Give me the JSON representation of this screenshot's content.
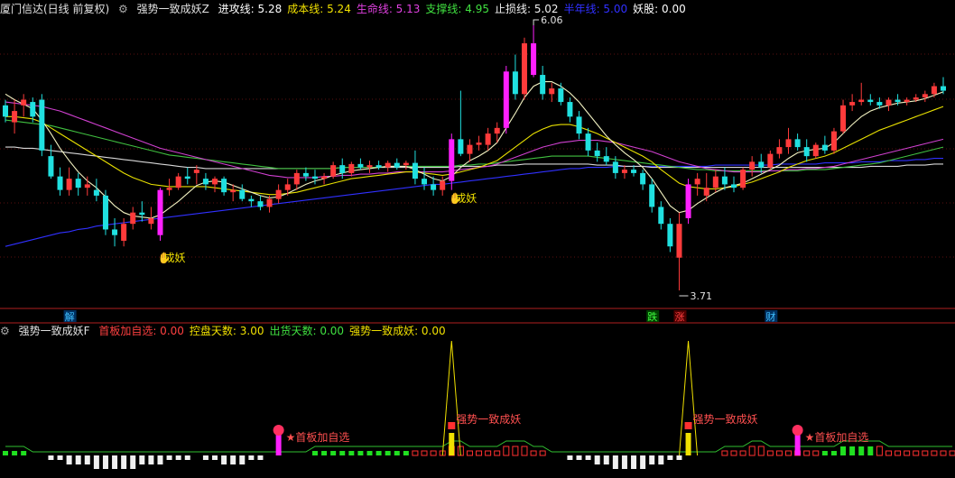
{
  "main": {
    "title": "厦门信达(日线 前复权)",
    "indicator": "强势一致成妖Z",
    "lines": [
      {
        "label": "进攻线: 5.28",
        "color": "#ffffff"
      },
      {
        "label": "成本线: 5.24",
        "color": "#f0e000"
      },
      {
        "label": "生命线: 5.13",
        "color": "#e040e0"
      },
      {
        "label": "支撑线: 4.95",
        "color": "#40e040"
      },
      {
        "label": "止损线: 5.02",
        "color": "#f0f0f0"
      },
      {
        "label": "半年线: 5.00",
        "color": "#3030ff"
      },
      {
        "label": "妖股: 0.00",
        "color": "#ffffff"
      }
    ],
    "high_label": "6.06",
    "low_label": "3.71",
    "signals": [
      "成妖",
      "成妖"
    ],
    "bottom_marks": [
      {
        "text": "解",
        "color": "#40c0ff",
        "bg": "#003060"
      },
      {
        "text": "跌",
        "color": "#40ff40",
        "bg": "#004000"
      },
      {
        "text": "涨",
        "color": "#ff4040",
        "bg": "#500000"
      },
      {
        "text": "财",
        "color": "#40c0ff",
        "bg": "#003060"
      }
    ]
  },
  "sub": {
    "indicator": "强势一致成妖F",
    "lines": [
      {
        "label": "首板加自选: 0.00",
        "color": "#ff4040"
      },
      {
        "label": "控盘天数: 3.00",
        "color": "#f0e000"
      },
      {
        "label": "出货天数: 0.00",
        "color": "#40e040"
      },
      {
        "label": "强势一致成妖: 0.00",
        "color": "#f0e000"
      }
    ],
    "annotations": [
      "★首板加自选",
      "强势一致成妖",
      "强势一致成妖",
      "★首板加自选"
    ]
  },
  "chart_data": {
    "type": "candlestick",
    "y_high": 6.06,
    "y_low": 3.71,
    "candles": [
      [
        5.35,
        5.4,
        5.2,
        5.25
      ],
      [
        5.2,
        5.4,
        5.1,
        5.3
      ],
      [
        5.35,
        5.45,
        5.25,
        5.4
      ],
      [
        5.38,
        5.42,
        5.2,
        5.25
      ],
      [
        5.4,
        5.45,
        4.9,
        4.95
      ],
      [
        4.9,
        5.0,
        4.7,
        4.72
      ],
      [
        4.72,
        4.8,
        4.55,
        4.6
      ],
      [
        4.6,
        4.8,
        4.55,
        4.7
      ],
      [
        4.7,
        4.75,
        4.55,
        4.62
      ],
      [
        4.62,
        4.72,
        4.55,
        4.65
      ],
      [
        4.6,
        4.7,
        4.5,
        4.55
      ],
      [
        4.55,
        4.6,
        4.2,
        4.25
      ],
      [
        4.25,
        4.35,
        4.1,
        4.2
      ],
      [
        4.15,
        4.35,
        4.1,
        4.3
      ],
      [
        4.3,
        4.45,
        4.25,
        4.4
      ],
      [
        4.4,
        4.5,
        4.32,
        4.38
      ],
      [
        4.3,
        4.45,
        4.25,
        4.35
      ],
      [
        4.2,
        4.62,
        4.15,
        4.6
      ],
      [
        4.6,
        4.7,
        4.55,
        4.62
      ],
      [
        4.62,
        4.75,
        4.6,
        4.72
      ],
      [
        4.72,
        4.8,
        4.65,
        4.7
      ],
      [
        4.75,
        4.82,
        4.65,
        4.78
      ],
      [
        4.7,
        4.75,
        4.6,
        4.65
      ],
      [
        4.65,
        4.72,
        4.58,
        4.7
      ],
      [
        4.7,
        4.72,
        4.55,
        4.58
      ],
      [
        4.58,
        4.65,
        4.5,
        4.6
      ],
      [
        4.6,
        4.65,
        4.5,
        4.52
      ],
      [
        4.52,
        4.55,
        4.45,
        4.5
      ],
      [
        4.5,
        4.55,
        4.42,
        4.45
      ],
      [
        4.45,
        4.55,
        4.4,
        4.52
      ],
      [
        4.52,
        4.65,
        4.48,
        4.6
      ],
      [
        4.6,
        4.7,
        4.55,
        4.65
      ],
      [
        4.65,
        4.78,
        4.6,
        4.75
      ],
      [
        4.75,
        4.8,
        4.68,
        4.72
      ],
      [
        4.72,
        4.78,
        4.65,
        4.7
      ],
      [
        4.7,
        4.75,
        4.65,
        4.72
      ],
      [
        4.72,
        4.85,
        4.7,
        4.82
      ],
      [
        4.82,
        4.88,
        4.7,
        4.75
      ],
      [
        4.75,
        4.85,
        4.72,
        4.83
      ],
      [
        4.83,
        4.88,
        4.78,
        4.8
      ],
      [
        4.8,
        4.86,
        4.75,
        4.82
      ],
      [
        4.82,
        4.86,
        4.78,
        4.8
      ],
      [
        4.8,
        4.86,
        4.76,
        4.84
      ],
      [
        4.84,
        4.88,
        4.78,
        4.8
      ],
      [
        4.82,
        4.86,
        4.78,
        4.84
      ],
      [
        4.84,
        4.95,
        4.65,
        4.7
      ],
      [
        4.7,
        4.8,
        4.6,
        4.65
      ],
      [
        4.65,
        4.72,
        4.55,
        4.6
      ],
      [
        4.6,
        4.72,
        4.55,
        4.68
      ],
      [
        4.68,
        5.1,
        4.6,
        5.05
      ],
      [
        5.05,
        5.48,
        4.9,
        4.92
      ],
      [
        4.92,
        5.05,
        4.85,
        5.0
      ],
      [
        5.0,
        5.08,
        4.95,
        5.02
      ],
      [
        5.0,
        5.15,
        4.95,
        5.1
      ],
      [
        5.1,
        5.2,
        5.02,
        5.15
      ],
      [
        5.15,
        5.7,
        5.1,
        5.65
      ],
      [
        5.65,
        5.8,
        5.4,
        5.45
      ],
      [
        5.45,
        5.95,
        5.4,
        5.9
      ],
      [
        5.9,
        6.06,
        5.6,
        5.62
      ],
      [
        5.62,
        5.7,
        5.4,
        5.45
      ],
      [
        5.45,
        5.55,
        5.38,
        5.5
      ],
      [
        5.5,
        5.55,
        5.35,
        5.38
      ],
      [
        5.38,
        5.42,
        5.2,
        5.25
      ],
      [
        5.25,
        5.3,
        5.05,
        5.1
      ],
      [
        5.1,
        5.15,
        4.9,
        4.95
      ],
      [
        4.95,
        5.02,
        4.85,
        4.9
      ],
      [
        4.9,
        4.98,
        4.82,
        4.85
      ],
      [
        4.85,
        4.9,
        4.7,
        4.75
      ],
      [
        4.75,
        4.82,
        4.7,
        4.78
      ],
      [
        4.78,
        4.82,
        4.72,
        4.75
      ],
      [
        4.75,
        4.78,
        4.6,
        4.65
      ],
      [
        4.65,
        4.7,
        4.4,
        4.45
      ],
      [
        4.45,
        4.5,
        4.25,
        4.3
      ],
      [
        4.3,
        4.35,
        4.05,
        4.1
      ],
      [
        4.0,
        4.4,
        3.71,
        4.3
      ],
      [
        4.35,
        4.7,
        4.3,
        4.65
      ],
      [
        4.65,
        4.75,
        4.55,
        4.7
      ],
      [
        4.55,
        4.75,
        4.5,
        4.62
      ],
      [
        4.62,
        4.78,
        4.58,
        4.72
      ],
      [
        4.72,
        4.8,
        4.6,
        4.65
      ],
      [
        4.65,
        4.72,
        4.58,
        4.62
      ],
      [
        4.62,
        4.8,
        4.6,
        4.78
      ],
      [
        4.78,
        4.9,
        4.72,
        4.85
      ],
      [
        4.85,
        4.92,
        4.75,
        4.8
      ],
      [
        4.8,
        4.95,
        4.78,
        4.92
      ],
      [
        4.92,
        5.05,
        4.88,
        4.98
      ],
      [
        4.98,
        5.15,
        4.92,
        5.05
      ],
      [
        5.05,
        5.1,
        4.95,
        4.98
      ],
      [
        4.98,
        5.05,
        4.85,
        4.9
      ],
      [
        4.9,
        5.02,
        4.88,
        5.0
      ],
      [
        5.0,
        5.08,
        4.92,
        4.95
      ],
      [
        4.95,
        5.15,
        4.92,
        5.12
      ],
      [
        5.12,
        5.4,
        5.1,
        5.35
      ],
      [
        5.35,
        5.45,
        5.3,
        5.38
      ],
      [
        5.38,
        5.55,
        5.35,
        5.4
      ],
      [
        5.4,
        5.45,
        5.35,
        5.38
      ],
      [
        5.38,
        5.42,
        5.32,
        5.35
      ],
      [
        5.35,
        5.42,
        5.3,
        5.4
      ],
      [
        5.4,
        5.45,
        5.35,
        5.38
      ],
      [
        5.38,
        5.42,
        5.35,
        5.4
      ],
      [
        5.4,
        5.45,
        5.38,
        5.42
      ],
      [
        5.42,
        5.48,
        5.38,
        5.45
      ],
      [
        5.45,
        5.55,
        5.42,
        5.52
      ],
      [
        5.52,
        5.6,
        5.45,
        5.48
      ]
    ],
    "ma_fast": [
      5.45,
      5.4,
      5.36,
      5.32,
      5.22,
      5.1,
      4.97,
      4.86,
      4.76,
      4.68,
      4.62,
      4.54,
      4.46,
      4.4,
      4.37,
      4.36,
      4.35,
      4.38,
      4.44,
      4.5,
      4.57,
      4.64,
      4.67,
      4.68,
      4.67,
      4.64,
      4.61,
      4.58,
      4.55,
      4.53,
      4.54,
      4.57,
      4.61,
      4.65,
      4.68,
      4.7,
      4.73,
      4.75,
      4.77,
      4.78,
      4.79,
      4.8,
      4.81,
      4.81,
      4.81,
      4.78,
      4.74,
      4.7,
      4.68,
      4.72,
      4.8,
      4.86,
      4.9,
      4.95,
      5.02,
      5.15,
      5.28,
      5.42,
      5.52,
      5.56,
      5.56,
      5.52,
      5.46,
      5.38,
      5.28,
      5.18,
      5.08,
      5.0,
      4.93,
      4.87,
      4.8,
      4.7,
      4.58,
      4.46,
      4.4,
      4.42,
      4.48,
      4.53,
      4.58,
      4.62,
      4.64,
      4.66,
      4.7,
      4.74,
      4.78,
      4.82,
      4.88,
      4.93,
      4.95,
      4.96,
      4.97,
      5.02,
      5.1,
      5.18,
      5.25,
      5.3,
      5.33,
      5.35,
      5.37,
      5.38,
      5.39,
      5.41,
      5.44,
      5.47
    ],
    "ma_mid": [
      5.25,
      5.25,
      5.24,
      5.23,
      5.2,
      5.15,
      5.1,
      5.05,
      5.0,
      4.95,
      4.9,
      4.85,
      4.8,
      4.75,
      4.71,
      4.68,
      4.65,
      4.64,
      4.63,
      4.63,
      4.63,
      4.63,
      4.63,
      4.62,
      4.61,
      4.6,
      4.59,
      4.58,
      4.57,
      4.56,
      4.56,
      4.57,
      4.58,
      4.6,
      4.62,
      4.64,
      4.66,
      4.68,
      4.7,
      4.71,
      4.72,
      4.73,
      4.74,
      4.75,
      4.76,
      4.76,
      4.75,
      4.74,
      4.73,
      4.74,
      4.76,
      4.78,
      4.8,
      4.83,
      4.86,
      4.92,
      4.98,
      5.04,
      5.1,
      5.14,
      5.17,
      5.18,
      5.18,
      5.16,
      5.13,
      5.1,
      5.06,
      5.02,
      4.98,
      4.94,
      4.9,
      4.85,
      4.78,
      4.72,
      4.66,
      4.63,
      4.62,
      4.61,
      4.61,
      4.62,
      4.63,
      4.65,
      4.67,
      4.7,
      4.73,
      4.76,
      4.8,
      4.83,
      4.86,
      4.88,
      4.9,
      4.93,
      4.97,
      5.01,
      5.05,
      5.09,
      5.13,
      5.16,
      5.19,
      5.22,
      5.25,
      5.28,
      5.31,
      5.34
    ],
    "ma_slow": [
      5.38,
      5.37,
      5.36,
      5.35,
      5.34,
      5.32,
      5.3,
      5.27,
      5.24,
      5.21,
      5.18,
      5.15,
      5.12,
      5.09,
      5.06,
      5.03,
      5.0,
      4.97,
      4.95,
      4.93,
      4.91,
      4.89,
      4.87,
      4.85,
      4.83,
      4.81,
      4.79,
      4.77,
      4.75,
      4.73,
      4.72,
      4.71,
      4.71,
      4.71,
      4.71,
      4.72,
      4.72,
      4.73,
      4.73,
      4.74,
      4.74,
      4.75,
      4.75,
      4.76,
      4.76,
      4.76,
      4.76,
      4.76,
      4.76,
      4.77,
      4.78,
      4.79,
      4.8,
      4.81,
      4.83,
      4.86,
      4.89,
      4.92,
      4.95,
      4.98,
      5.0,
      5.02,
      5.03,
      5.04,
      5.04,
      5.04,
      5.03,
      5.02,
      5.0,
      4.98,
      4.96,
      4.94,
      4.91,
      4.88,
      4.85,
      4.83,
      4.81,
      4.79,
      4.78,
      4.77,
      4.76,
      4.76,
      4.76,
      4.76,
      4.77,
      4.77,
      4.78,
      4.78,
      4.79,
      4.79,
      4.8,
      4.81,
      4.83,
      4.85,
      4.87,
      4.89,
      4.91,
      4.93,
      4.95,
      4.97,
      4.99,
      5.01,
      5.03,
      5.05
    ],
    "ma_green": [
      5.22,
      5.21,
      5.2,
      5.19,
      5.18,
      5.17,
      5.15,
      5.13,
      5.11,
      5.09,
      5.07,
      5.05,
      5.03,
      5.01,
      4.99,
      4.97,
      4.95,
      4.93,
      4.91,
      4.9,
      4.89,
      4.88,
      4.87,
      4.86,
      4.85,
      4.84,
      4.83,
      4.82,
      4.81,
      4.8,
      4.79,
      4.79,
      4.79,
      4.79,
      4.79,
      4.79,
      4.79,
      4.8,
      4.8,
      4.8,
      4.8,
      4.8,
      4.81,
      4.81,
      4.81,
      4.81,
      4.81,
      4.81,
      4.81,
      4.81,
      4.82,
      4.82,
      4.83,
      4.83,
      4.84,
      4.85,
      4.86,
      4.87,
      4.88,
      4.89,
      4.9,
      4.9,
      4.9,
      4.9,
      4.9,
      4.89,
      4.88,
      4.87,
      4.86,
      4.85,
      4.84,
      4.83,
      4.82,
      4.81,
      4.8,
      4.79,
      4.78,
      4.78,
      4.77,
      4.77,
      4.77,
      4.77,
      4.77,
      4.77,
      4.77,
      4.77,
      4.77,
      4.77,
      4.78,
      4.78,
      4.78,
      4.79,
      4.8,
      4.81,
      4.82,
      4.83,
      4.84,
      4.86,
      4.88,
      4.9,
      4.92,
      4.94,
      4.96,
      4.98
    ],
    "ma_grey": [
      4.98,
      4.98,
      4.97,
      4.97,
      4.96,
      4.95,
      4.94,
      4.93,
      4.92,
      4.91,
      4.9,
      4.89,
      4.88,
      4.87,
      4.86,
      4.85,
      4.84,
      4.83,
      4.82,
      4.81,
      4.8,
      4.8,
      4.79,
      4.79,
      4.79,
      4.79,
      4.79,
      4.79,
      4.79,
      4.79,
      4.79,
      4.79,
      4.79,
      4.79,
      4.79,
      4.79,
      4.79,
      4.8,
      4.8,
      4.8,
      4.8,
      4.8,
      4.8,
      4.8,
      4.8,
      4.8,
      4.8,
      4.8,
      4.8,
      4.8,
      4.81,
      4.81,
      4.81,
      4.81,
      4.82,
      4.82,
      4.82,
      4.83,
      4.83,
      4.83,
      4.83,
      4.83,
      4.83,
      4.83,
      4.83,
      4.82,
      4.82,
      4.82,
      4.81,
      4.81,
      4.81,
      4.8,
      4.8,
      4.8,
      4.8,
      4.8,
      4.8,
      4.8,
      4.8,
      4.8,
      4.8,
      4.8,
      4.8,
      4.8,
      4.8,
      4.8,
      4.8,
      4.8,
      4.8,
      4.8,
      4.8,
      4.8,
      4.8,
      4.8,
      4.8,
      4.81,
      4.81,
      4.81,
      4.81,
      4.82,
      4.82,
      4.82,
      4.83,
      4.83
    ],
    "ma_blue": [
      4.1,
      4.12,
      4.14,
      4.16,
      4.18,
      4.2,
      4.22,
      4.23,
      4.25,
      4.26,
      4.28,
      4.29,
      4.3,
      4.31,
      4.32,
      4.33,
      4.34,
      4.35,
      4.36,
      4.37,
      4.38,
      4.39,
      4.4,
      4.41,
      4.42,
      4.43,
      4.44,
      4.45,
      4.46,
      4.47,
      4.48,
      4.49,
      4.5,
      4.51,
      4.52,
      4.53,
      4.54,
      4.55,
      4.56,
      4.57,
      4.58,
      4.59,
      4.6,
      4.61,
      4.62,
      4.63,
      4.64,
      4.65,
      4.65,
      4.66,
      4.67,
      4.68,
      4.69,
      4.7,
      4.71,
      4.72,
      4.73,
      4.74,
      4.75,
      4.76,
      4.77,
      4.78,
      4.79,
      4.79,
      4.8,
      4.8,
      4.8,
      4.81,
      4.81,
      4.81,
      4.81,
      4.81,
      4.81,
      4.81,
      4.81,
      4.81,
      4.81,
      4.81,
      4.82,
      4.82,
      4.82,
      4.82,
      4.82,
      4.82,
      4.82,
      4.83,
      4.83,
      4.83,
      4.83,
      4.83,
      4.84,
      4.84,
      4.84,
      4.84,
      4.85,
      4.85,
      4.85,
      4.86,
      4.86,
      4.86,
      4.87,
      4.87,
      4.88,
      4.88
    ],
    "sub_bars": [
      1,
      1,
      1,
      0,
      0,
      -1,
      -1,
      -2,
      -2,
      -2,
      -3,
      -3,
      -3,
      -3,
      -3,
      -2,
      -2,
      -2,
      -1,
      -1,
      -1,
      0,
      -1,
      -1,
      -2,
      -2,
      -2,
      -1,
      -1,
      0,
      0,
      0,
      0,
      0,
      1,
      1,
      1,
      1,
      1,
      1,
      1,
      1,
      1,
      1,
      1,
      1,
      1,
      1,
      1,
      2,
      2,
      1,
      1,
      1,
      1,
      2,
      2,
      2,
      1,
      1,
      0,
      0,
      -1,
      -1,
      -1,
      -2,
      -2,
      -3,
      -3,
      -3,
      -3,
      -2,
      -2,
      -1,
      -1,
      0,
      0,
      0,
      0,
      1,
      1,
      1,
      2,
      2,
      1,
      1,
      1,
      1,
      1,
      1,
      1,
      1,
      2,
      2,
      2,
      2,
      2,
      1,
      1,
      1,
      1,
      1,
      1,
      1,
      1
    ],
    "spikes": [
      49,
      75
    ]
  }
}
